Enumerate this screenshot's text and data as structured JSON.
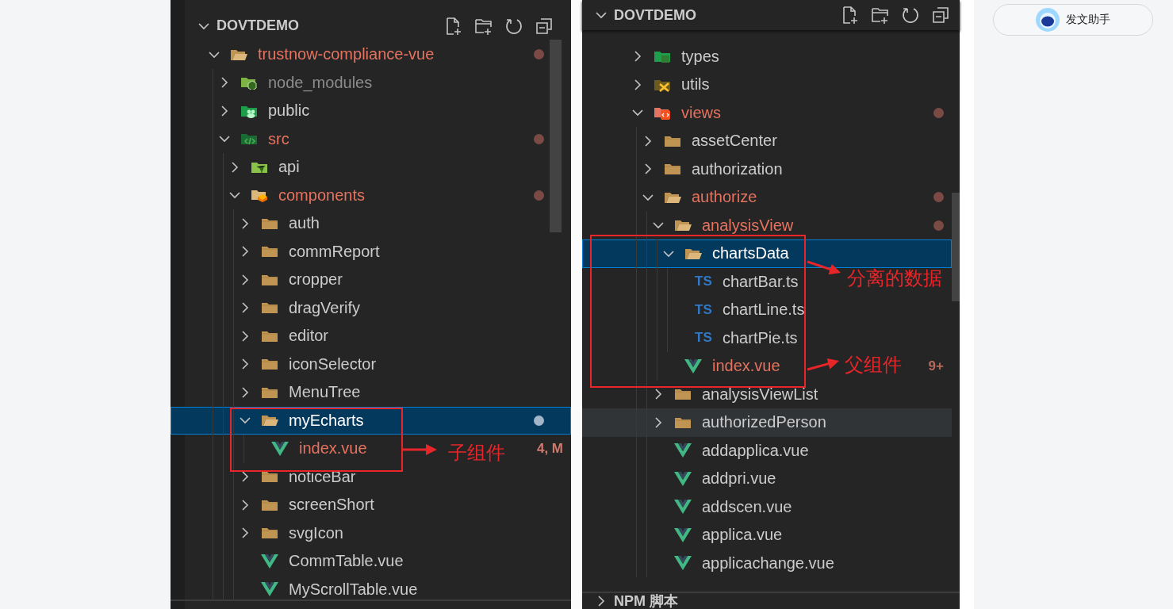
{
  "panels": [
    {
      "title": "DOVTDEMO",
      "tree": [
        {
          "label": "trustnow-compliance-vue",
          "kind": "folder",
          "modified": true,
          "ignored": false,
          "expanded": true,
          "selected": false,
          "hovered": false,
          "children": [
            {
              "label": "node_modules",
              "kind": "node-folder",
              "modified": false,
              "ignored": true,
              "expanded": false,
              "selected": false,
              "hovered": false
            },
            {
              "label": "public",
              "kind": "public-folder",
              "modified": false,
              "ignored": false,
              "expanded": false,
              "selected": false,
              "hovered": false
            },
            {
              "label": "src",
              "kind": "src-folder",
              "modified": true,
              "ignored": false,
              "expanded": true,
              "selected": false,
              "hovered": false,
              "children": [
                {
                  "label": "api",
                  "kind": "api-folder",
                  "modified": false,
                  "ignored": false,
                  "expanded": false,
                  "selected": false,
                  "hovered": false
                },
                {
                  "label": "components",
                  "kind": "components-folder",
                  "modified": true,
                  "ignored": false,
                  "expanded": true,
                  "selected": false,
                  "hovered": false,
                  "children": [
                    {
                      "label": "auth",
                      "kind": "folder",
                      "modified": false,
                      "ignored": false,
                      "expanded": false,
                      "selected": false,
                      "hovered": false
                    },
                    {
                      "label": "commReport",
                      "kind": "folder",
                      "modified": false,
                      "ignored": false,
                      "expanded": false,
                      "selected": false,
                      "hovered": false
                    },
                    {
                      "label": "cropper",
                      "kind": "folder",
                      "modified": false,
                      "ignored": false,
                      "expanded": false,
                      "selected": false,
                      "hovered": false
                    },
                    {
                      "label": "dragVerify",
                      "kind": "folder",
                      "modified": false,
                      "ignored": false,
                      "expanded": false,
                      "selected": false,
                      "hovered": false
                    },
                    {
                      "label": "editor",
                      "kind": "folder",
                      "modified": false,
                      "ignored": false,
                      "expanded": false,
                      "selected": false,
                      "hovered": false
                    },
                    {
                      "label": "iconSelector",
                      "kind": "folder",
                      "modified": false,
                      "ignored": false,
                      "expanded": false,
                      "selected": false,
                      "hovered": false
                    },
                    {
                      "label": "MenuTree",
                      "kind": "folder",
                      "modified": false,
                      "ignored": false,
                      "expanded": false,
                      "selected": false,
                      "hovered": false
                    },
                    {
                      "label": "myEcharts",
                      "kind": "folder",
                      "modified": true,
                      "ignored": false,
                      "expanded": true,
                      "selected": true,
                      "hovered": false,
                      "children": [
                        {
                          "label": "index.vue",
                          "kind": "vue-file",
                          "modified": true,
                          "ignored": false,
                          "selected": false,
                          "hovered": false,
                          "badge": "4, M"
                        }
                      ]
                    },
                    {
                      "label": "noticeBar",
                      "kind": "folder",
                      "modified": false,
                      "ignored": false,
                      "expanded": false,
                      "selected": false,
                      "hovered": false
                    },
                    {
                      "label": "screenShort",
                      "kind": "folder",
                      "modified": false,
                      "ignored": false,
                      "expanded": false,
                      "selected": false,
                      "hovered": false
                    },
                    {
                      "label": "svgIcon",
                      "kind": "folder",
                      "modified": false,
                      "ignored": false,
                      "expanded": false,
                      "selected": false,
                      "hovered": false
                    },
                    {
                      "label": "CommTable.vue",
                      "kind": "vue-file",
                      "modified": false,
                      "ignored": false,
                      "selected": false,
                      "hovered": false
                    },
                    {
                      "label": "MyScrollTable.vue",
                      "kind": "vue-file",
                      "modified": false,
                      "ignored": false,
                      "selected": false,
                      "hovered": false
                    }
                  ]
                }
              ]
            }
          ]
        }
      ],
      "callouts": [
        {
          "label": "子组件"
        }
      ]
    },
    {
      "title": "DOVTDEMO",
      "tree": [
        {
          "label": "types",
          "kind": "types-folder",
          "modified": false,
          "ignored": false,
          "expanded": false,
          "selected": false,
          "hovered": false
        },
        {
          "label": "utils",
          "kind": "utils-folder",
          "modified": false,
          "ignored": false,
          "expanded": false,
          "selected": false,
          "hovered": false
        },
        {
          "label": "views",
          "kind": "views-folder",
          "modified": true,
          "ignored": false,
          "expanded": true,
          "selected": false,
          "hovered": false,
          "children": [
            {
              "label": "assetCenter",
              "kind": "folder",
              "modified": false,
              "ignored": false,
              "expanded": false,
              "selected": false,
              "hovered": false
            },
            {
              "label": "authorization",
              "kind": "folder",
              "modified": false,
              "ignored": false,
              "expanded": false,
              "selected": false,
              "hovered": false
            },
            {
              "label": "authorize",
              "kind": "folder",
              "modified": true,
              "ignored": false,
              "expanded": true,
              "selected": false,
              "hovered": false,
              "children": [
                {
                  "label": "analysisView",
                  "kind": "folder",
                  "modified": true,
                  "ignored": false,
                  "expanded": true,
                  "selected": false,
                  "hovered": false,
                  "children": [
                    {
                      "label": "chartsData",
                      "kind": "folder",
                      "modified": false,
                      "ignored": false,
                      "expanded": true,
                      "selected": true,
                      "hovered": false,
                      "children": [
                        {
                          "label": "chartBar.ts",
                          "kind": "ts-file",
                          "icon_text": "TS",
                          "modified": false,
                          "ignored": false,
                          "selected": false,
                          "hovered": false
                        },
                        {
                          "label": "chartLine.ts",
                          "kind": "ts-file",
                          "icon_text": "TS",
                          "modified": false,
                          "ignored": false,
                          "selected": false,
                          "hovered": false
                        },
                        {
                          "label": "chartPie.ts",
                          "kind": "ts-file",
                          "icon_text": "TS",
                          "modified": false,
                          "ignored": false,
                          "selected": false,
                          "hovered": false
                        }
                      ]
                    },
                    {
                      "label": "index.vue",
                      "kind": "vue-file",
                      "modified": true,
                      "ignored": false,
                      "selected": false,
                      "hovered": false,
                      "badge": "9+"
                    }
                  ]
                },
                {
                  "label": "analysisViewList",
                  "kind": "folder",
                  "modified": false,
                  "ignored": false,
                  "expanded": false,
                  "selected": false,
                  "hovered": false
                },
                {
                  "label": "authorizedPerson",
                  "kind": "folder",
                  "modified": false,
                  "ignored": false,
                  "expanded": false,
                  "selected": false,
                  "hovered": true
                },
                {
                  "label": "addapplica.vue",
                  "kind": "vue-file",
                  "modified": false,
                  "ignored": false,
                  "selected": false,
                  "hovered": false
                },
                {
                  "label": "addpri.vue",
                  "kind": "vue-file",
                  "modified": false,
                  "ignored": false,
                  "selected": false,
                  "hovered": false
                },
                {
                  "label": "addscen.vue",
                  "kind": "vue-file",
                  "modified": false,
                  "ignored": false,
                  "selected": false,
                  "hovered": false
                },
                {
                  "label": "applica.vue",
                  "kind": "vue-file",
                  "modified": false,
                  "ignored": false,
                  "selected": false,
                  "hovered": false
                },
                {
                  "label": "applicachange.vue",
                  "kind": "vue-file",
                  "modified": false,
                  "ignored": false,
                  "selected": false,
                  "hovered": false
                }
              ]
            }
          ]
        }
      ],
      "callouts": [
        {
          "label": "分离的数据"
        },
        {
          "label": "父组件"
        }
      ],
      "footer": {
        "label": "NPM 脚本",
        "expanded": false
      }
    }
  ],
  "assistant_button": {
    "label": "发文助手"
  }
}
